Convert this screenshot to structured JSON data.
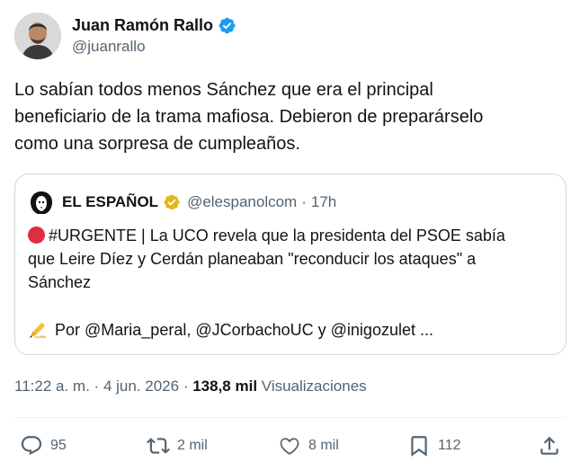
{
  "author": {
    "name": "Juan Ramón Rallo",
    "handle": "@juanrallo",
    "avatar_icon": "avatar-photo",
    "verified_icon": "verified-badge-blue"
  },
  "tweet": {
    "line1": "Lo sabían todos menos Sánchez que era el principal",
    "line2": "beneficiario de la trama mafiosa. Debieron de preparárselo",
    "line3": "como una sorpresa de cumpleaños."
  },
  "quote": {
    "name": "EL ESPAÑOL",
    "handle": "@elespanolcom",
    "separator": "·",
    "time": "17h",
    "badge_icon": "verified-badge-gold",
    "line1": "#URGENTE | La UCO revela que la presidenta del PSOE sabía",
    "line2": "que Leire Díez y Cerdán planeaban \"reconducir los ataques\" a",
    "line3": "Sánchez",
    "byline": "Por @Maria_peral, @JCorbachoUC y @inigozulet ..."
  },
  "meta": {
    "time": "11:22 a. m.",
    "separator": "·",
    "date": "4 jun. 2026",
    "views_count": "138,8 mil",
    "views_label": "Visualizaciones"
  },
  "actions": {
    "replies": "95",
    "retweets": "2 mil",
    "likes": "8 mil",
    "bookmarks": "112"
  },
  "colors": {
    "text": "#0f1419",
    "secondary": "#536471",
    "verified_blue": "#1d9bf0",
    "verified_gold": "#e2b719",
    "border": "#cfd9de"
  }
}
